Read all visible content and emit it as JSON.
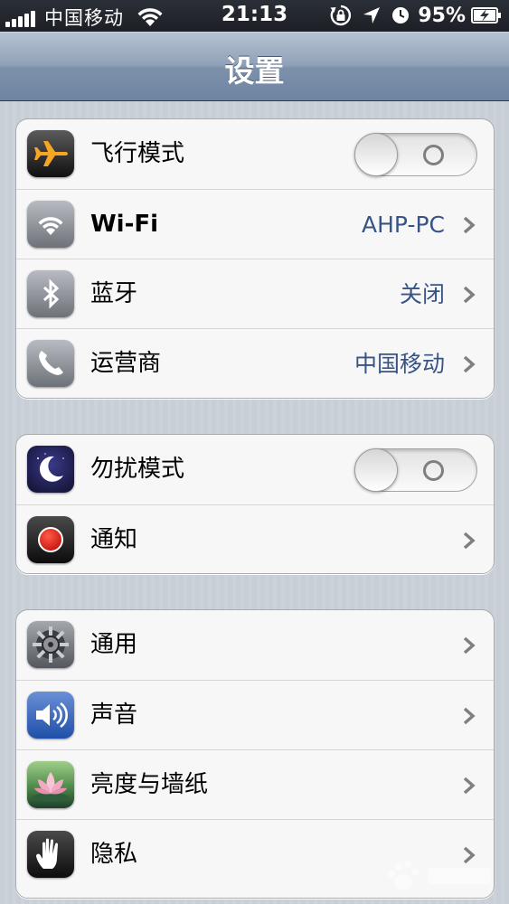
{
  "status_bar": {
    "carrier": "中国移动",
    "time": "21:13",
    "battery": "95%"
  },
  "nav": {
    "title": "设置"
  },
  "groups": [
    {
      "rows": [
        {
          "icon": "airplane-icon",
          "label": "飞行模式",
          "toggle": "off"
        },
        {
          "icon": "wifi-icon",
          "label": "Wi-Fi",
          "value": "AHP-PC"
        },
        {
          "icon": "bluetooth-icon",
          "label": "蓝牙",
          "value": "关闭"
        },
        {
          "icon": "phone-icon",
          "label": "运营商",
          "value": "中国移动"
        }
      ]
    },
    {
      "rows": [
        {
          "icon": "moon-icon",
          "label": "勿扰模式",
          "toggle": "off"
        },
        {
          "icon": "notification-icon",
          "label": "通知"
        }
      ]
    },
    {
      "rows": [
        {
          "icon": "gear-icon",
          "label": "通用"
        },
        {
          "icon": "speaker-icon",
          "label": "声音"
        },
        {
          "icon": "lotus-icon",
          "label": "亮度与墙纸"
        },
        {
          "icon": "hand-icon",
          "label": "隐私"
        }
      ]
    }
  ],
  "colors": {
    "value_text": "#385487",
    "nav_bar": "#7d91ab",
    "background": "#c5ccd4"
  }
}
